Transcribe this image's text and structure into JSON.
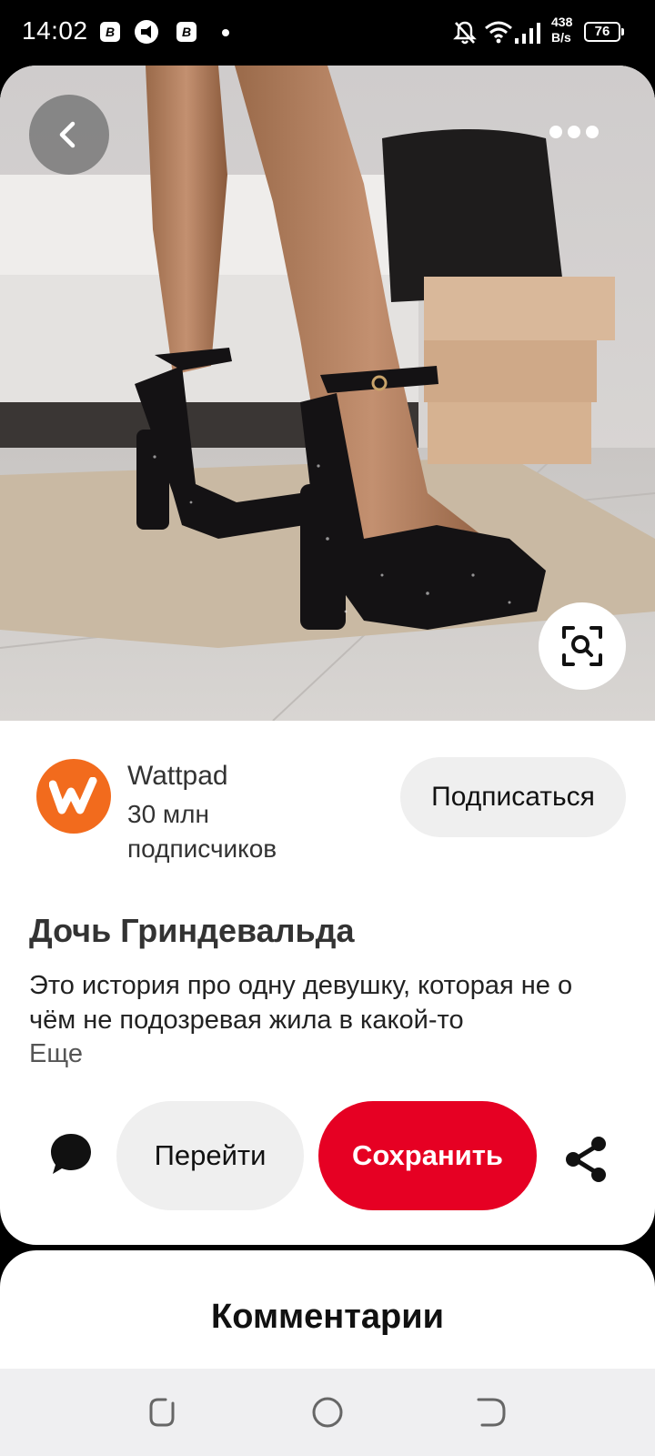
{
  "status_bar": {
    "time": "14:02",
    "notification_icons": [
      "bitcoin-app-icon",
      "megaphone-icon",
      "bitcoin-app-icon",
      "dot-icon"
    ],
    "network_speed_value": "438",
    "network_speed_unit": "B/s",
    "battery_level": "76",
    "system_icons": [
      "mute-bell-icon",
      "wifi-icon",
      "signal-icon"
    ]
  },
  "pin": {
    "image_alt_icons": [
      "back-arrow-icon",
      "more-dots-icon",
      "visual-search-icon"
    ],
    "creator": {
      "name": "Wattpad",
      "followers": "30 млн подписчиков",
      "avatar_color": "#f26b1d"
    },
    "follow_label": "Подписаться",
    "title": "Дочь Гриндевальда",
    "description": "Это история про одну девушку, которая не о чём не подозревая жила в какой-то",
    "more_label": "Еще",
    "actions": {
      "goto_label": "Перейти",
      "save_label": "Сохранить",
      "save_color": "#e60023"
    }
  },
  "comments": {
    "title": "Комментарии"
  },
  "nav_bar": {
    "buttons": [
      "recents-icon",
      "home-icon",
      "back-icon"
    ]
  }
}
